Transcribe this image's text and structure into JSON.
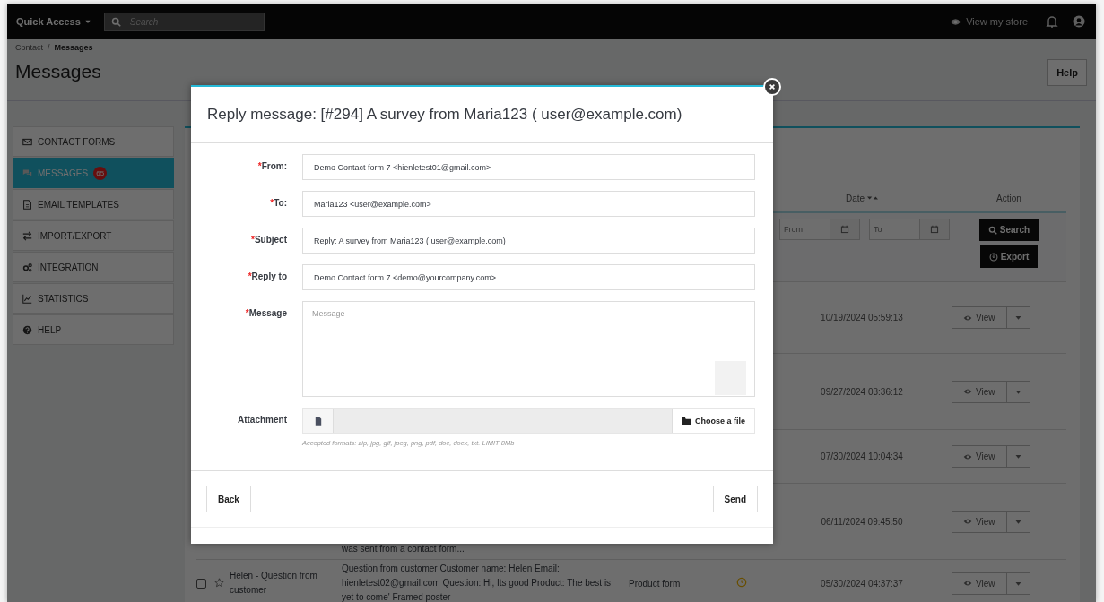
{
  "top_bar": {
    "quick_access": "Quick Access",
    "search": {
      "placeholder": "Search"
    },
    "view_store": "View my store"
  },
  "breadcrumb": {
    "separator": "/",
    "items": [
      {
        "label": "Contact",
        "current": false
      },
      {
        "label": "Messages",
        "current": true
      }
    ]
  },
  "page_title": "Messages",
  "help_button": "Help",
  "sidebar": {
    "items": [
      {
        "label": "CONTACT FORMS",
        "selected": false
      },
      {
        "label": "MESSAGES",
        "selected": true,
        "badge": "65"
      },
      {
        "label": "EMAIL TEMPLATES",
        "selected": false
      },
      {
        "label": "IMPORT/EXPORT",
        "selected": false
      },
      {
        "label": "INTEGRATION",
        "selected": false
      },
      {
        "label": "STATISTICS",
        "selected": false
      },
      {
        "label": "HELP",
        "selected": false
      }
    ]
  },
  "table": {
    "columns": [
      {
        "label": "Date"
      },
      {
        "label": "Action"
      }
    ],
    "filters": {
      "from": {
        "placeholder": "From"
      },
      "to": {
        "placeholder": "To"
      },
      "search_button": "Search",
      "export_button": "Export"
    },
    "rows": [
      {
        "date": "10/19/2024 05:59:13",
        "action": "View"
      },
      {
        "date": "09/27/2024 03:36:12",
        "action": "View"
      },
      {
        "date": "07/30/2024 10:04:34",
        "action": "View"
      },
      {
        "message": "was sent from a contact form...",
        "date": "06/11/2024 09:45:50",
        "action": "View"
      },
      {
        "checked": false,
        "starred": false,
        "name": "Helen - Question from customer",
        "message": "Question from customer Customer name: Helen Email: hienletest02@gmail.com Question:  Hi, Its good Product: The best is yet to come' Framed poster",
        "form": "Product form",
        "date": "05/30/2024 04:37:37",
        "action": "View"
      }
    ]
  },
  "modal": {
    "title": "Reply message: [#294] A survey from Maria123 ( user@example.com)",
    "required_mark": "*",
    "fields": [
      {
        "kind": "input",
        "label": "From:",
        "required": true,
        "value": "Demo Contact form 7 <hienletest01@gmail.com>"
      },
      {
        "kind": "input",
        "label": "To:",
        "required": true,
        "value": "Maria123 <user@example.com>"
      },
      {
        "kind": "input",
        "label": "Subject",
        "required": true,
        "value": "Reply: A survey from Maria123 ( user@example.com)"
      },
      {
        "kind": "input",
        "label": "Reply to",
        "required": true,
        "value": "Demo Contact form 7 <demo@yourcompany.com>"
      },
      {
        "kind": "textarea",
        "label": "Message",
        "required": true,
        "placeholder": "Message"
      },
      {
        "kind": "file",
        "label": "Attachment",
        "required": false,
        "button": "Choose a file",
        "hint": "Accepted formats: zip, jpg, gif, jpeg, png, pdf, doc, docx, txt. LIMIT 8Mb"
      }
    ],
    "back_button": "Back",
    "send_button": "Send"
  }
}
